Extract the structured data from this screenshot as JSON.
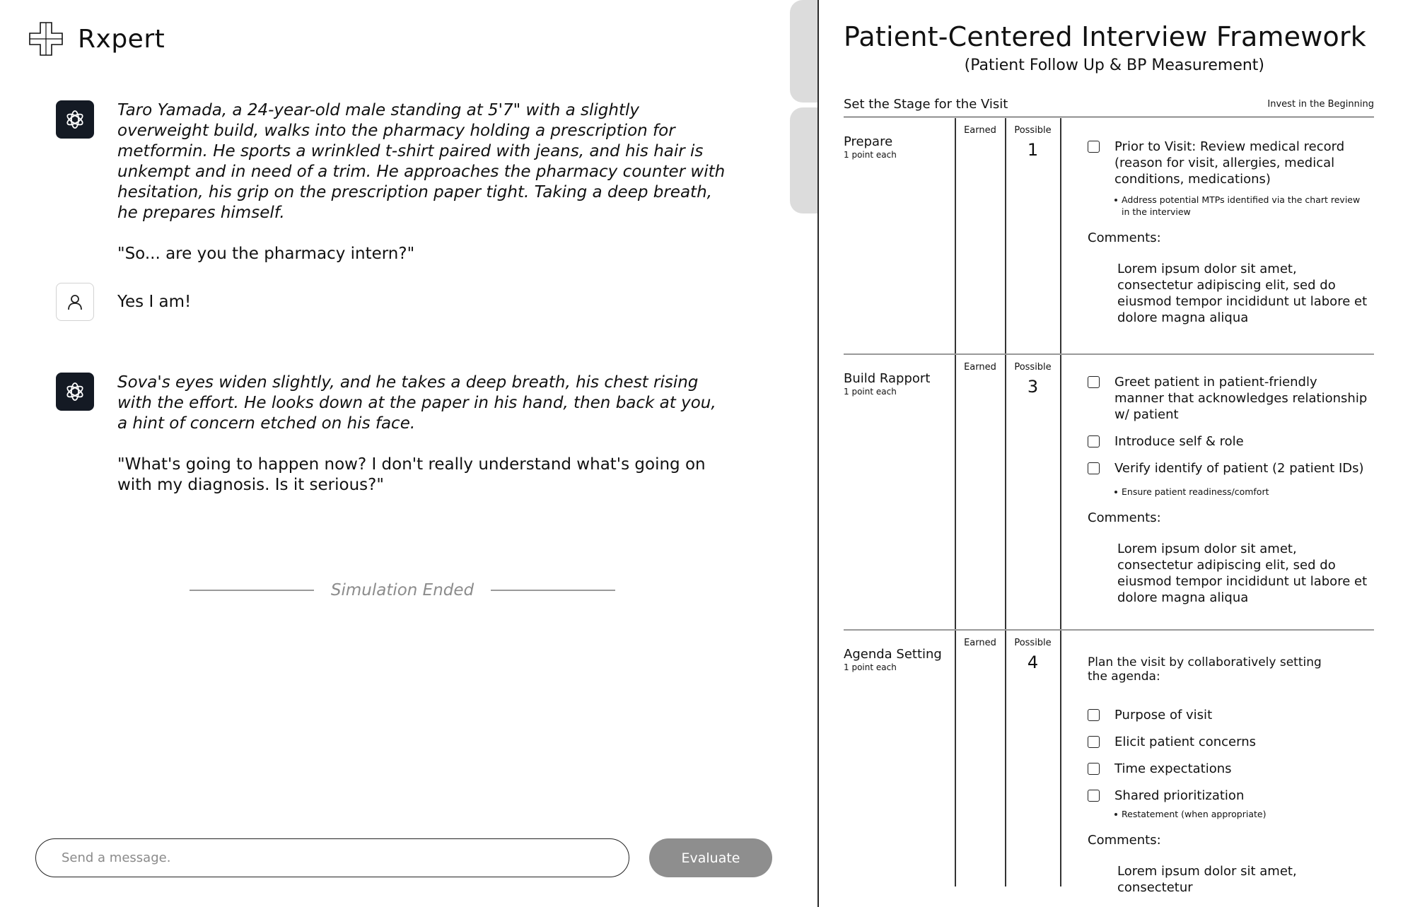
{
  "app": {
    "name": "Rxpert"
  },
  "chat": {
    "messages": [
      {
        "role": "assistant",
        "narration": "Taro Yamada, a 24-year-old male standing at 5'7\" with a slightly overweight build, walks into the pharmacy holding a prescription for metformin. He sports a wrinkled t-shirt paired with jeans, and his hair is unkempt and in need of a trim. He approaches the pharmacy counter with hesitation, his grip on the prescription paper tight. Taking a deep breath, he prepares himself.",
        "quote": "\"So... are you the pharmacy intern?\""
      },
      {
        "role": "user",
        "text": "Yes I am!"
      },
      {
        "role": "assistant",
        "narration": "Sova's eyes widen slightly, and he takes a deep breath, his chest rising with the effort. He looks down at the paper in his hand, then back at you, a hint of concern etched on his face.",
        "quote": "\"What's going to happen now? I don't really understand what's going on with my diagnosis. Is it serious?\""
      }
    ],
    "status": "Simulation Ended",
    "input": {
      "placeholder": "Send a message.",
      "value": ""
    },
    "evaluate_label": "Evaluate"
  },
  "rubric": {
    "title": "Patient-Centered Interview Framework",
    "subtitle": "(Patient Follow Up & BP Measurement)",
    "stage": {
      "title": "Set the Stage for the Visit",
      "note": "Invest in the Beginning"
    },
    "columns": {
      "earned": "Earned",
      "possible": "Possible"
    },
    "comments_label": "Comments:",
    "sections": [
      {
        "name": "Prepare",
        "points_note": "1 point each",
        "possible": "1",
        "items": [
          "Prior to Visit: Review medical record (reason for visit, allergies, medical conditions, medications)"
        ],
        "sub_bullets": [
          "Address potential MTPs identified via the chart review in the interview"
        ],
        "comments": "Lorem ipsum dolor sit amet, consectetur adipiscing elit, sed do eiusmod tempor incididunt ut labore et dolore magna aliqua"
      },
      {
        "name": "Build Rapport",
        "points_note": "1 point each",
        "possible": "3",
        "items": [
          "Greet patient in patient-friendly manner that acknowledges relationship w/ patient",
          "Introduce self & role",
          "Verify identify of patient (2 patient IDs)"
        ],
        "sub_bullets": [
          "Ensure patient readiness/comfort"
        ],
        "comments": "Lorem ipsum dolor sit amet, consectetur adipiscing elit, sed do eiusmod tempor incididunt ut labore et dolore magna aliqua"
      },
      {
        "name": "Agenda Setting",
        "points_note": "1 point each",
        "possible": "4",
        "intro": "Plan the visit by collaboratively setting the agenda:",
        "items": [
          "Purpose of visit",
          "Elicit patient concerns",
          "Time expectations",
          "Shared prioritization"
        ],
        "sub_bullets": [
          "Restatement (when appropriate)"
        ],
        "comments": "Lorem ipsum dolor sit amet, consectetur"
      }
    ]
  },
  "icons": {
    "logo": "medical-cross-logo",
    "assistant_avatar": "openai-logo-icon",
    "user_avatar": "user-icon"
  },
  "colors": {
    "assistant_avatar_bg": "#141a24",
    "evaluate_button_bg": "#8e8e8e",
    "tab_handle": "#dcdcdc"
  }
}
